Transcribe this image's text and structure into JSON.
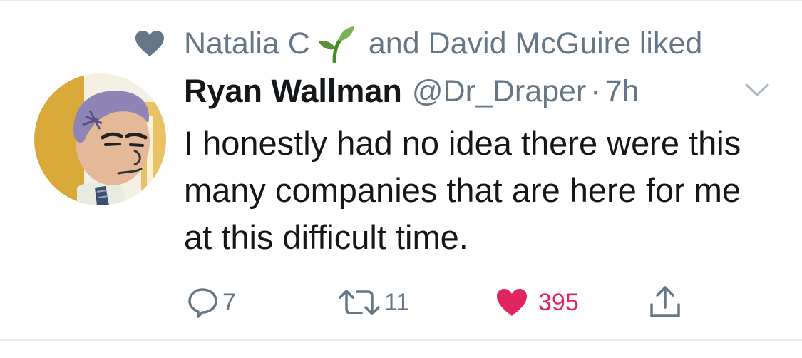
{
  "social_context": {
    "icon": "heart-icon",
    "user1": "Natalia C",
    "user1_emoji": "seedling",
    "rest": "and David McGuire liked"
  },
  "tweet": {
    "display_name": "Ryan Wallman",
    "handle": "@Dr_Draper",
    "separator": "·",
    "time": "7h",
    "text": "I honestly had no idea there were this many companies that are here for me at this difficult time."
  },
  "actions": {
    "reply_count": "7",
    "retweet_count": "11",
    "like_count": "395",
    "like_color": "#e0245e"
  },
  "colors": {
    "text": "#14171a",
    "secondary": "#657786",
    "like": "#e0245e",
    "rule": "#e6ecf0"
  }
}
